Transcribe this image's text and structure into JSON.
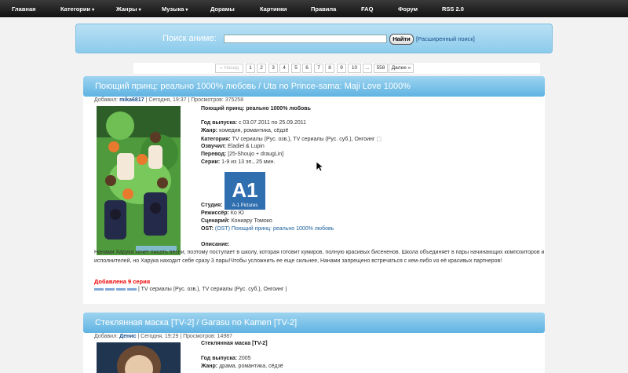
{
  "nav": [
    {
      "label": "Главная",
      "has_dropdown": false
    },
    {
      "label": "Категории",
      "has_dropdown": true
    },
    {
      "label": "Жанры",
      "has_dropdown": true
    },
    {
      "label": "Музыка",
      "has_dropdown": true
    },
    {
      "label": "Дорамы",
      "has_dropdown": false
    },
    {
      "label": "Картинки",
      "has_dropdown": false
    },
    {
      "label": "Правила",
      "has_dropdown": false
    },
    {
      "label": "FAQ",
      "has_dropdown": false
    },
    {
      "label": "Форум",
      "has_dropdown": false
    },
    {
      "label": "RSS 2.0",
      "has_dropdown": false
    }
  ],
  "nav_arrow": "▾",
  "search": {
    "label": "Поиск аниме:",
    "value": "",
    "button": "Найти",
    "advanced": "[Расширенный поиск]"
  },
  "pager": [
    "« Назад",
    "1",
    "2",
    "3",
    "4",
    "5",
    "6",
    "7",
    "8",
    "9",
    "10",
    "...",
    "558",
    "Далее »"
  ],
  "posts": [
    {
      "title": "Поющий принц: реально 1000% любовь / Uta no Prince-sama: Maji Love 1000%",
      "meta": {
        "added_label": "Добавил:",
        "author": "mika6817",
        "date": "| Сегодня, 19:37 | Просмотров: 375258"
      },
      "name_line": "Поющий принц: реально 1000% любовь",
      "fields": [
        {
          "label": "Год выпуска:",
          "value": " с 03.07.2011 по 25.09.2011"
        },
        {
          "label": "Жанр:",
          "value": " комедия, романтика, сёдзё"
        },
        {
          "label": "Категория:",
          "value": " TV сериалы (Рус. озв.), TV сериалы (Рус. суб.), Онгоинг ⬚"
        },
        {
          "label": "Озвучил:",
          "value": " Eladiel & Lupin"
        },
        {
          "label": "Перевод:",
          "value": " [25-Shoujo + draugLin]"
        },
        {
          "label": "Серии:",
          "value": " 1-9 из 13 эп., 25 мин."
        }
      ],
      "studio_label": "Студия:",
      "studio_logo_text": "A-1 Pictures",
      "fields2": [
        {
          "label": "Режиссёр:",
          "value": " Ко Ю"
        },
        {
          "label": "Сценарий:",
          "value": " Кониару Томоко"
        },
        {
          "label": "OST:",
          "value": " (OST) Поющий принц: реально 1000% любовь"
        }
      ],
      "desc_label": "Описание:",
      "description": "Нанами Харука хочет писать песни, поэтому поступает в школу, которая готовит кумиров, полную красивых бисененов. Школа объединяет в пары начинающих композиторов и исполнителей, но Харука находит себе сразу 3 пары!Чтобы усложнить ее еще сильнее, Нанами запрещено встречаться с кем-либо из её красивых партнеров!",
      "added": "Добавлена 9 серия",
      "tags": "| TV сериалы (Рус. озв.), TV сериалы (Рус. суб.), Онгоинг |"
    },
    {
      "title": "Стеклянная маска [TV-2] / Garasu no Kamen [TV-2]",
      "meta": {
        "added_label": "Добавил:",
        "author": "Денис",
        "date": "| Сегодня, 19:29 | Просмотров: 14987"
      },
      "name_line": "Стеклянная маска [TV-2]",
      "fields": [
        {
          "label": "Год выпуска:",
          "value": " 2005"
        },
        {
          "label": "Жанр:",
          "value": " драма, романтика, сёдзё"
        }
      ]
    }
  ],
  "colors": {
    "accent": "#5fb3e2",
    "link": "#1b4f8a",
    "added": "#e00000"
  }
}
